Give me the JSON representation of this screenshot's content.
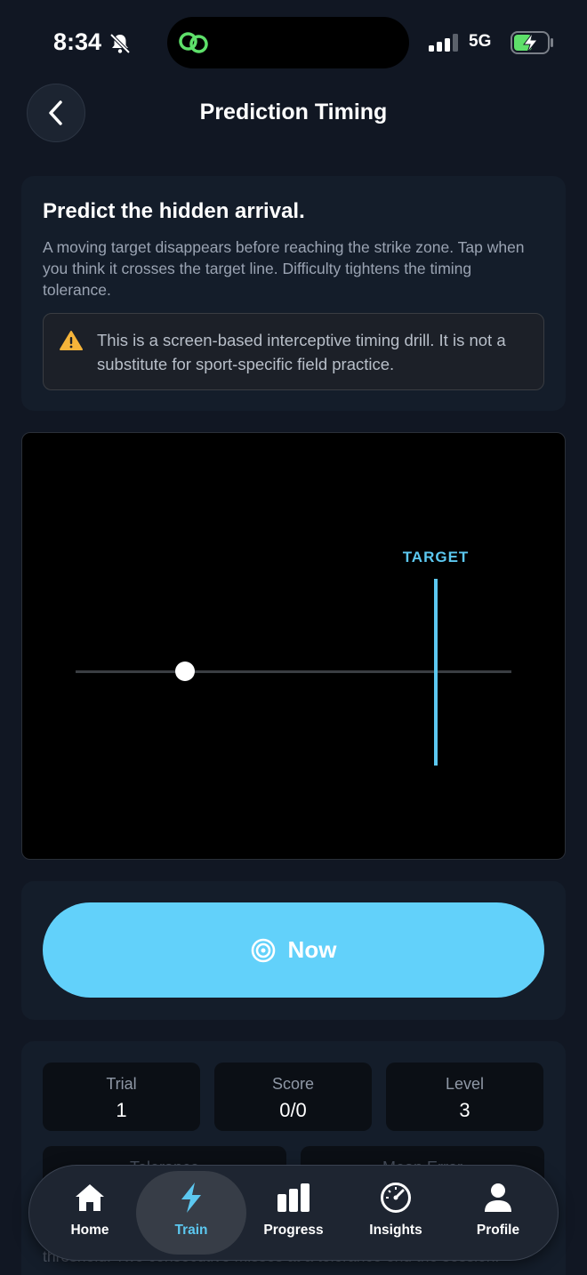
{
  "status_bar": {
    "time": "8:34",
    "network": "5G",
    "icons": [
      "bell-slash-icon",
      "link-icon",
      "signal-icon",
      "battery-charging-icon"
    ]
  },
  "header": {
    "title": "Prediction Timing",
    "back_icon": "chevron-left-icon"
  },
  "intro": {
    "title": "Predict the hidden arrival.",
    "description": "A moving target disappears before reaching the strike zone. Tap when you think it crosses the target line. Difficulty tightens the timing tolerance.",
    "warning": "This is a screen-based interceptive timing drill. It is not a substitute for sport-specific field practice."
  },
  "drill": {
    "target_label": "TARGET",
    "target_color": "#5cc8f0"
  },
  "action": {
    "button_label": "Now",
    "button_color": "#62d1fa",
    "icon": "target-icon"
  },
  "stats": {
    "items": [
      {
        "label": "Trial",
        "value": "1"
      },
      {
        "label": "Score",
        "value": "0/0"
      },
      {
        "label": "Level",
        "value": "3"
      }
    ],
    "secondary": [
      {
        "label": "Tolerance"
      },
      {
        "label": "Mean Error"
      }
    ],
    "footer_text": "threshold. Two consecutive misses at a tolerance end the session."
  },
  "tabs": [
    {
      "label": "Home",
      "icon": "home-icon",
      "active": false
    },
    {
      "label": "Train",
      "icon": "bolt-icon",
      "active": true
    },
    {
      "label": "Progress",
      "icon": "bar-chart-icon",
      "active": false
    },
    {
      "label": "Insights",
      "icon": "gauge-icon",
      "active": false
    },
    {
      "label": "Profile",
      "icon": "person-icon",
      "active": false
    }
  ]
}
